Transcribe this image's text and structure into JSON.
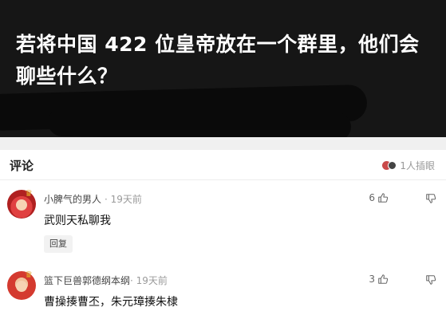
{
  "header": {
    "title": "若将中国 422 位皇帝放在一个群里，他们会聊些什么？"
  },
  "comments_section": {
    "title": "评论",
    "insert_info": "1人插眼"
  },
  "comments": [
    {
      "username": "小脾气的男人",
      "time": "· 19天前",
      "text": "武则天私聊我",
      "likes": "6",
      "reply_label": "回复"
    },
    {
      "username": "篮下巨兽郭德纲本纲",
      "time": "· 19天前",
      "text": "曹操揍曹丕，朱元璋揍朱棣",
      "likes": "3"
    }
  ],
  "icons": {
    "like": "thumbs-up-icon",
    "dislike": "thumbs-down-icon",
    "crown": "crown-icon"
  }
}
